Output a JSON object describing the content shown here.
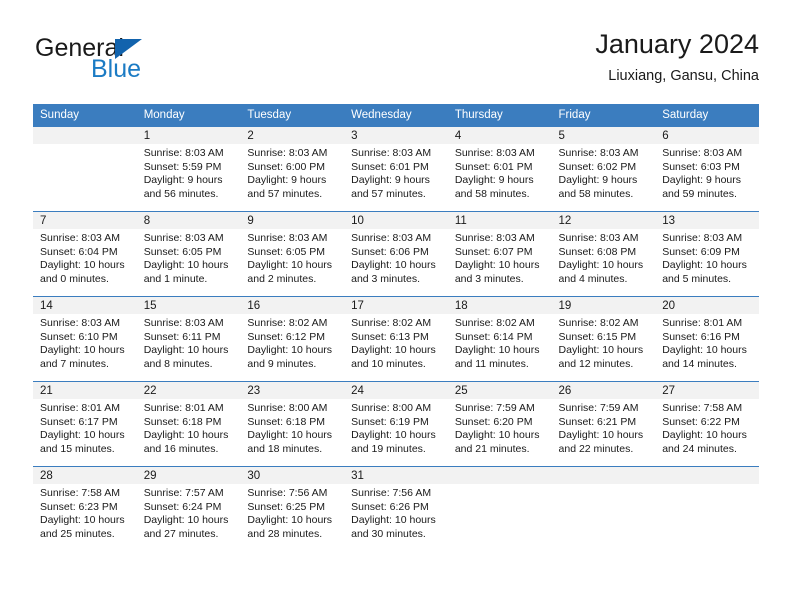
{
  "brand": {
    "name_part1": "General",
    "name_part2": "Blue",
    "accent_color": "#1b7bc4",
    "triangle_color": "#1263ad"
  },
  "header": {
    "title": "January 2024",
    "subtitle": "Liuxiang, Gansu, China"
  },
  "calendar": {
    "header_bg": "#3b7dbf",
    "daynum_band_bg": "#f2f2f2",
    "weekday_headers": [
      "Sunday",
      "Monday",
      "Tuesday",
      "Wednesday",
      "Thursday",
      "Friday",
      "Saturday"
    ],
    "weeks": [
      [
        {
          "day": "",
          "sunrise": "",
          "sunset": "",
          "daylight_line1": "",
          "daylight_line2": ""
        },
        {
          "day": "1",
          "sunrise": "Sunrise: 8:03 AM",
          "sunset": "Sunset: 5:59 PM",
          "daylight_line1": "Daylight: 9 hours",
          "daylight_line2": "and 56 minutes."
        },
        {
          "day": "2",
          "sunrise": "Sunrise: 8:03 AM",
          "sunset": "Sunset: 6:00 PM",
          "daylight_line1": "Daylight: 9 hours",
          "daylight_line2": "and 57 minutes."
        },
        {
          "day": "3",
          "sunrise": "Sunrise: 8:03 AM",
          "sunset": "Sunset: 6:01 PM",
          "daylight_line1": "Daylight: 9 hours",
          "daylight_line2": "and 57 minutes."
        },
        {
          "day": "4",
          "sunrise": "Sunrise: 8:03 AM",
          "sunset": "Sunset: 6:01 PM",
          "daylight_line1": "Daylight: 9 hours",
          "daylight_line2": "and 58 minutes."
        },
        {
          "day": "5",
          "sunrise": "Sunrise: 8:03 AM",
          "sunset": "Sunset: 6:02 PM",
          "daylight_line1": "Daylight: 9 hours",
          "daylight_line2": "and 58 minutes."
        },
        {
          "day": "6",
          "sunrise": "Sunrise: 8:03 AM",
          "sunset": "Sunset: 6:03 PM",
          "daylight_line1": "Daylight: 9 hours",
          "daylight_line2": "and 59 minutes."
        }
      ],
      [
        {
          "day": "7",
          "sunrise": "Sunrise: 8:03 AM",
          "sunset": "Sunset: 6:04 PM",
          "daylight_line1": "Daylight: 10 hours",
          "daylight_line2": "and 0 minutes."
        },
        {
          "day": "8",
          "sunrise": "Sunrise: 8:03 AM",
          "sunset": "Sunset: 6:05 PM",
          "daylight_line1": "Daylight: 10 hours",
          "daylight_line2": "and 1 minute."
        },
        {
          "day": "9",
          "sunrise": "Sunrise: 8:03 AM",
          "sunset": "Sunset: 6:05 PM",
          "daylight_line1": "Daylight: 10 hours",
          "daylight_line2": "and 2 minutes."
        },
        {
          "day": "10",
          "sunrise": "Sunrise: 8:03 AM",
          "sunset": "Sunset: 6:06 PM",
          "daylight_line1": "Daylight: 10 hours",
          "daylight_line2": "and 3 minutes."
        },
        {
          "day": "11",
          "sunrise": "Sunrise: 8:03 AM",
          "sunset": "Sunset: 6:07 PM",
          "daylight_line1": "Daylight: 10 hours",
          "daylight_line2": "and 3 minutes."
        },
        {
          "day": "12",
          "sunrise": "Sunrise: 8:03 AM",
          "sunset": "Sunset: 6:08 PM",
          "daylight_line1": "Daylight: 10 hours",
          "daylight_line2": "and 4 minutes."
        },
        {
          "day": "13",
          "sunrise": "Sunrise: 8:03 AM",
          "sunset": "Sunset: 6:09 PM",
          "daylight_line1": "Daylight: 10 hours",
          "daylight_line2": "and 5 minutes."
        }
      ],
      [
        {
          "day": "14",
          "sunrise": "Sunrise: 8:03 AM",
          "sunset": "Sunset: 6:10 PM",
          "daylight_line1": "Daylight: 10 hours",
          "daylight_line2": "and 7 minutes."
        },
        {
          "day": "15",
          "sunrise": "Sunrise: 8:03 AM",
          "sunset": "Sunset: 6:11 PM",
          "daylight_line1": "Daylight: 10 hours",
          "daylight_line2": "and 8 minutes."
        },
        {
          "day": "16",
          "sunrise": "Sunrise: 8:02 AM",
          "sunset": "Sunset: 6:12 PM",
          "daylight_line1": "Daylight: 10 hours",
          "daylight_line2": "and 9 minutes."
        },
        {
          "day": "17",
          "sunrise": "Sunrise: 8:02 AM",
          "sunset": "Sunset: 6:13 PM",
          "daylight_line1": "Daylight: 10 hours",
          "daylight_line2": "and 10 minutes."
        },
        {
          "day": "18",
          "sunrise": "Sunrise: 8:02 AM",
          "sunset": "Sunset: 6:14 PM",
          "daylight_line1": "Daylight: 10 hours",
          "daylight_line2": "and 11 minutes."
        },
        {
          "day": "19",
          "sunrise": "Sunrise: 8:02 AM",
          "sunset": "Sunset: 6:15 PM",
          "daylight_line1": "Daylight: 10 hours",
          "daylight_line2": "and 12 minutes."
        },
        {
          "day": "20",
          "sunrise": "Sunrise: 8:01 AM",
          "sunset": "Sunset: 6:16 PM",
          "daylight_line1": "Daylight: 10 hours",
          "daylight_line2": "and 14 minutes."
        }
      ],
      [
        {
          "day": "21",
          "sunrise": "Sunrise: 8:01 AM",
          "sunset": "Sunset: 6:17 PM",
          "daylight_line1": "Daylight: 10 hours",
          "daylight_line2": "and 15 minutes."
        },
        {
          "day": "22",
          "sunrise": "Sunrise: 8:01 AM",
          "sunset": "Sunset: 6:18 PM",
          "daylight_line1": "Daylight: 10 hours",
          "daylight_line2": "and 16 minutes."
        },
        {
          "day": "23",
          "sunrise": "Sunrise: 8:00 AM",
          "sunset": "Sunset: 6:18 PM",
          "daylight_line1": "Daylight: 10 hours",
          "daylight_line2": "and 18 minutes."
        },
        {
          "day": "24",
          "sunrise": "Sunrise: 8:00 AM",
          "sunset": "Sunset: 6:19 PM",
          "daylight_line1": "Daylight: 10 hours",
          "daylight_line2": "and 19 minutes."
        },
        {
          "day": "25",
          "sunrise": "Sunrise: 7:59 AM",
          "sunset": "Sunset: 6:20 PM",
          "daylight_line1": "Daylight: 10 hours",
          "daylight_line2": "and 21 minutes."
        },
        {
          "day": "26",
          "sunrise": "Sunrise: 7:59 AM",
          "sunset": "Sunset: 6:21 PM",
          "daylight_line1": "Daylight: 10 hours",
          "daylight_line2": "and 22 minutes."
        },
        {
          "day": "27",
          "sunrise": "Sunrise: 7:58 AM",
          "sunset": "Sunset: 6:22 PM",
          "daylight_line1": "Daylight: 10 hours",
          "daylight_line2": "and 24 minutes."
        }
      ],
      [
        {
          "day": "28",
          "sunrise": "Sunrise: 7:58 AM",
          "sunset": "Sunset: 6:23 PM",
          "daylight_line1": "Daylight: 10 hours",
          "daylight_line2": "and 25 minutes."
        },
        {
          "day": "29",
          "sunrise": "Sunrise: 7:57 AM",
          "sunset": "Sunset: 6:24 PM",
          "daylight_line1": "Daylight: 10 hours",
          "daylight_line2": "and 27 minutes."
        },
        {
          "day": "30",
          "sunrise": "Sunrise: 7:56 AM",
          "sunset": "Sunset: 6:25 PM",
          "daylight_line1": "Daylight: 10 hours",
          "daylight_line2": "and 28 minutes."
        },
        {
          "day": "31",
          "sunrise": "Sunrise: 7:56 AM",
          "sunset": "Sunset: 6:26 PM",
          "daylight_line1": "Daylight: 10 hours",
          "daylight_line2": "and 30 minutes."
        },
        {
          "day": "",
          "sunrise": "",
          "sunset": "",
          "daylight_line1": "",
          "daylight_line2": ""
        },
        {
          "day": "",
          "sunrise": "",
          "sunset": "",
          "daylight_line1": "",
          "daylight_line2": ""
        },
        {
          "day": "",
          "sunrise": "",
          "sunset": "",
          "daylight_line1": "",
          "daylight_line2": ""
        }
      ]
    ]
  }
}
